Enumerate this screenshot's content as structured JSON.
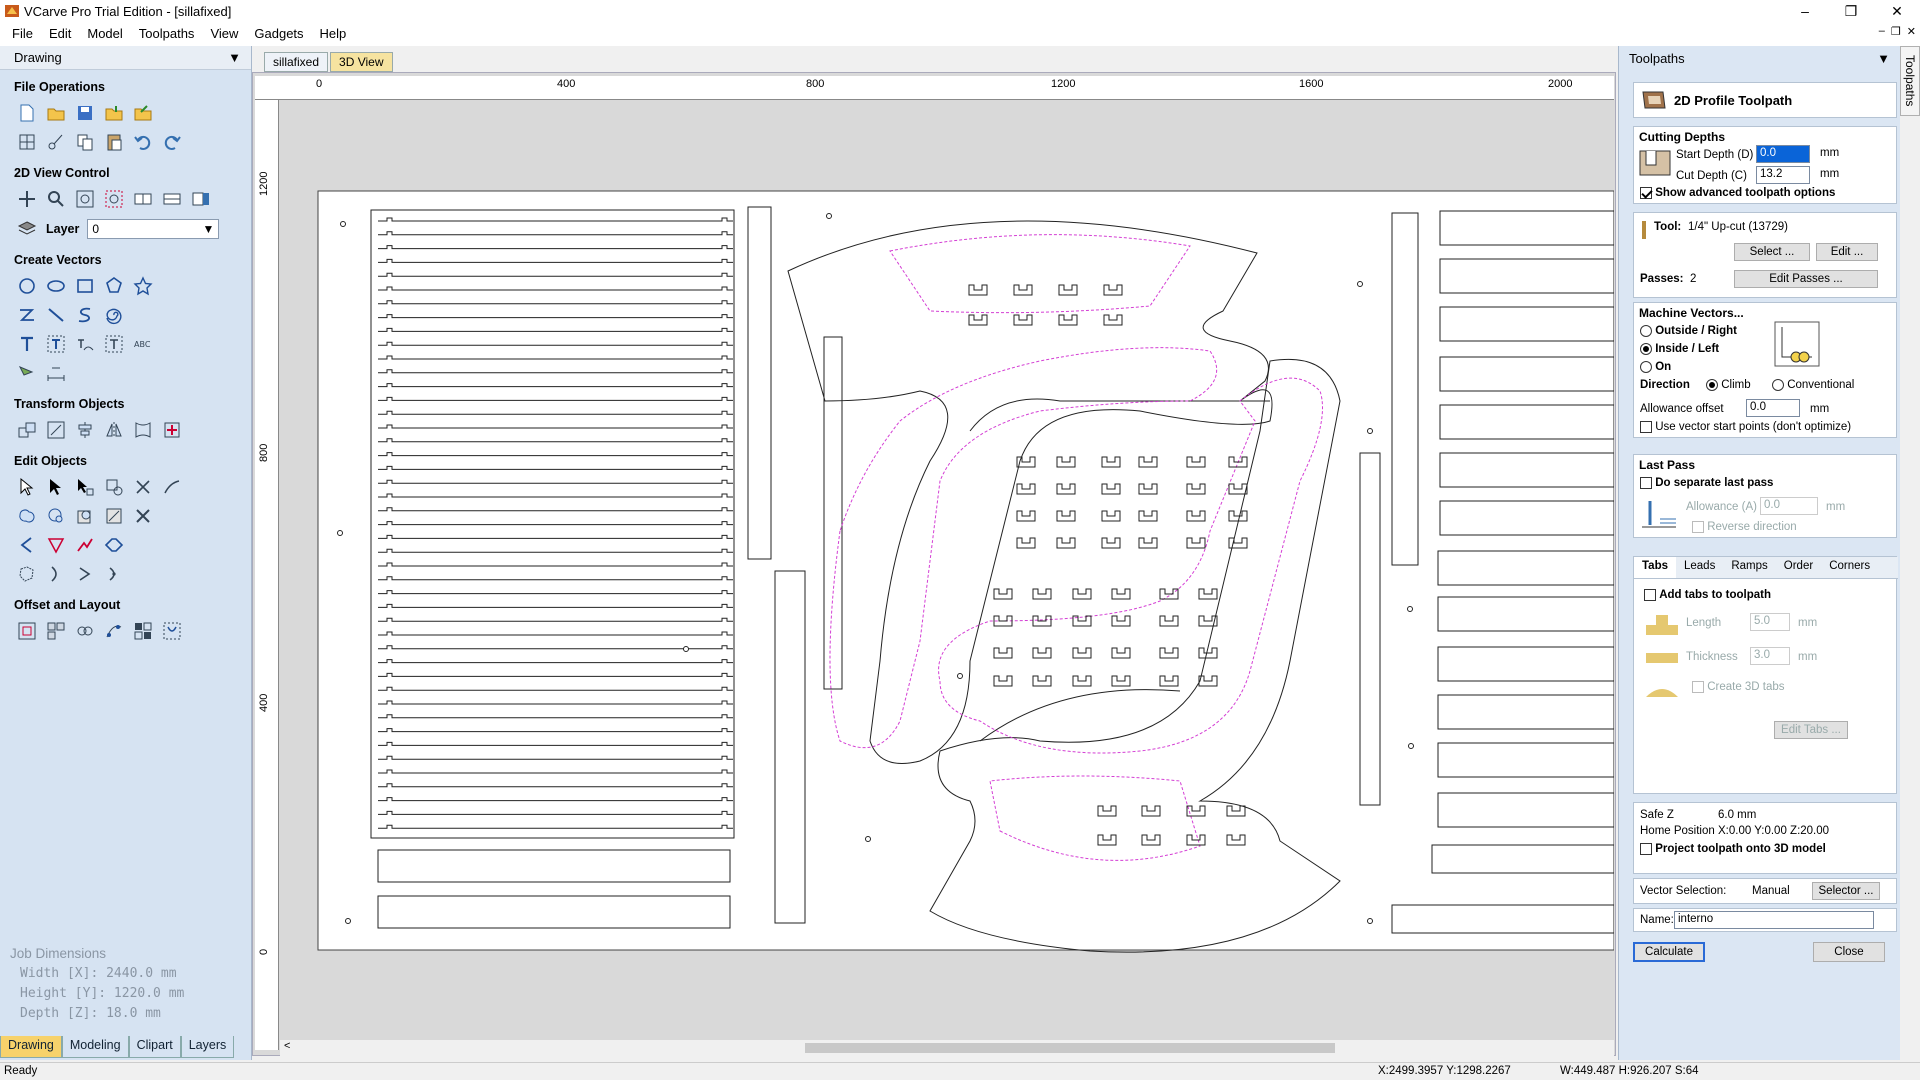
{
  "window": {
    "title": "VCarve Pro Trial Edition - [sillafixed]"
  },
  "menu": [
    "File",
    "Edit",
    "Model",
    "Toolpaths",
    "View",
    "Gadgets",
    "Help"
  ],
  "left_panel": {
    "title": "Drawing",
    "sections": {
      "file_ops": "File Operations",
      "view_ctrl": "2D View Control",
      "create_vectors": "Create Vectors",
      "transform": "Transform Objects",
      "edit": "Edit Objects",
      "offset": "Offset and Layout"
    },
    "layer_label": "Layer",
    "layer_value": "0",
    "job": {
      "title": "Job Dimensions",
      "width": "Width  [X]: 2440.0 mm",
      "height": "Height [Y]: 1220.0 mm",
      "depth": "Depth  [Z]: 18.0 mm"
    },
    "tabs": [
      "Drawing",
      "Modeling",
      "Clipart",
      "Layers"
    ]
  },
  "doc_tabs": [
    "sillafixed",
    "3D View"
  ],
  "ruler": {
    "h": [
      "0",
      "400",
      "800",
      "1200",
      "1600",
      "2000"
    ],
    "v": [
      "1200",
      "800",
      "400",
      "0"
    ]
  },
  "toolpath": {
    "panel_title": "Toolpaths",
    "name": "2D Profile Toolpath",
    "cutting_depths": "Cutting Depths",
    "start_depth_label": "Start Depth (D)",
    "start_depth": "0.0",
    "cut_depth_label": "Cut Depth (C)",
    "cut_depth": "13.2",
    "unit": "mm",
    "show_advanced": "Show advanced toolpath options",
    "tool_label": "Tool:",
    "tool_value": "1/4\" Up-cut (13729)",
    "select_btn": "Select ...",
    "edit_btn": "Edit ...",
    "passes_label": "Passes:",
    "passes_value": "2",
    "edit_passes_btn": "Edit Passes ...",
    "machine_vectors": "Machine Vectors...",
    "outside": "Outside / Right",
    "inside": "Inside / Left",
    "on": "On",
    "direction": "Direction",
    "climb": "Climb",
    "conventional": "Conventional",
    "allowance_label": "Allowance offset",
    "allowance_value": "0.0",
    "use_start": "Use vector start points (don't optimize)",
    "last_pass": "Last Pass",
    "separate_last": "Do separate last pass",
    "lp_allowance_label": "Allowance (A)",
    "lp_allowance": "0.0",
    "reverse_dir": "Reverse direction",
    "tabs": [
      "Tabs",
      "Leads",
      "Ramps",
      "Order",
      "Corners"
    ],
    "add_tabs": "Add tabs to toolpath",
    "length_label": "Length",
    "length_value": "5.0",
    "thickness_label": "Thickness",
    "thickness_value": "3.0",
    "create3d": "Create 3D tabs",
    "edit_tabs_btn": "Edit Tabs ...",
    "safez_label": "Safe Z",
    "safez_value": "6.0 mm",
    "home_label": "Home Position",
    "home_value": "X:0.00 Y:0.00 Z:20.00",
    "project_3d": "Project toolpath onto 3D model",
    "vec_sel_label": "Vector Selection:",
    "vec_sel_value": "Manual",
    "selector_btn": "Selector ...",
    "name_label": "Name:",
    "name_value": "interno",
    "calculate": "Calculate",
    "close": "Close"
  },
  "side_tab": "Toolpaths",
  "status": {
    "ready": "Ready",
    "coords": "X:2499.3957 Y:1298.2267",
    "size": "W:449.487  H:926.207  S:64"
  }
}
